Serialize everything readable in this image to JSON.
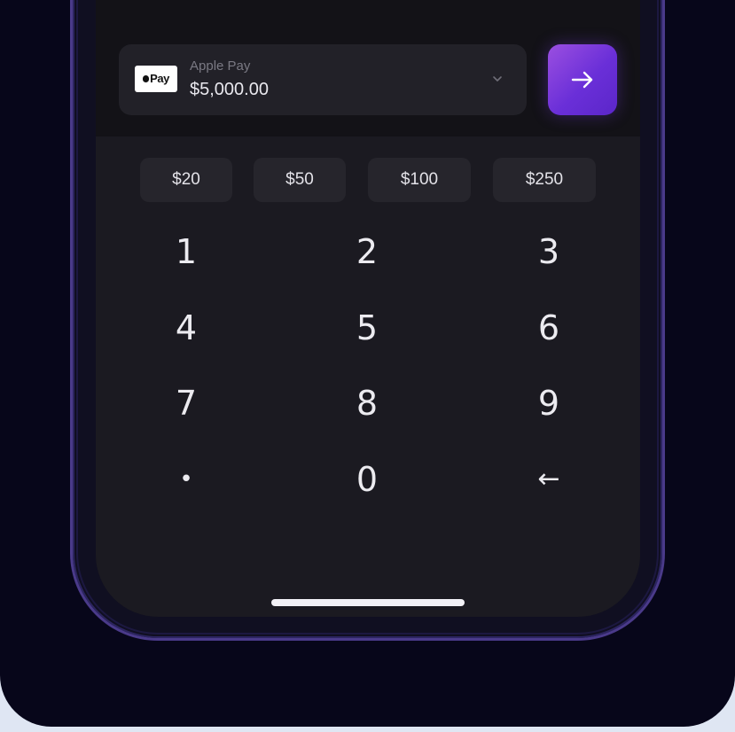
{
  "payment": {
    "method_label": "Apple Pay",
    "badge_text": "Pay",
    "amount": "$5,000.00",
    "icon": "chevron-down-icon"
  },
  "submit": {
    "icon": "arrow-right-icon",
    "accent_colors": [
      "#9b4fe0",
      "#5b26c9"
    ]
  },
  "quick_amounts": [
    "$20",
    "$50",
    "$100",
    "$250"
  ],
  "keypad": {
    "rows": [
      [
        "1",
        "2",
        "3"
      ],
      [
        "4",
        "5",
        "6"
      ],
      [
        "7",
        "8",
        "9"
      ],
      [
        "•",
        "0",
        "←"
      ]
    ],
    "backspace_icon": "arrow-left-icon"
  },
  "colors": {
    "page_background": "#07061a",
    "screen_background": "#1b1a21",
    "panel_background": "#131217",
    "chip_background": "#26252c",
    "text": "#ecebf0"
  }
}
